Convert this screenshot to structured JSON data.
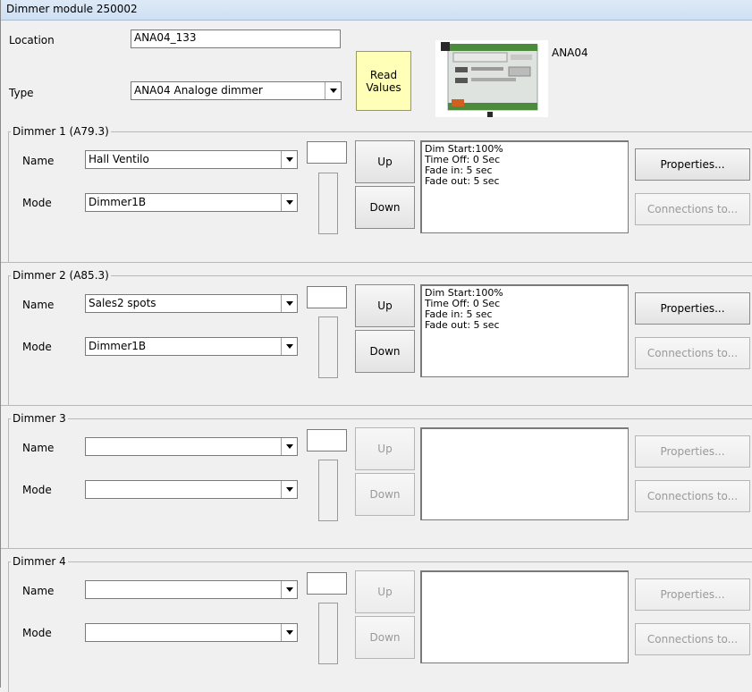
{
  "title": "Dimmer module 250002",
  "location": {
    "label": "Location",
    "value": "ANA04_133"
  },
  "type": {
    "label": "Type",
    "value": "ANA04 Analoge dimmer"
  },
  "read_values": {
    "label_line1": "Read",
    "label_line2": "Values"
  },
  "device_image_label": "ANA04",
  "dimmers": [
    {
      "legend": "Dimmer 1 (A79.3)",
      "name_label": "Name",
      "name_value": "Hall Ventilo",
      "mode_label": "Mode",
      "mode_value": "Dimmer1B",
      "up": "Up",
      "down": "Down",
      "info": [
        "Dim Start:100%",
        "Time Off: 0 Sec",
        "Fade in:  5 sec",
        "Fade out:  5 sec"
      ],
      "properties": "Properties...",
      "connections": "Connections to..."
    },
    {
      "legend": "Dimmer 2 (A85.3)",
      "name_label": "Name",
      "name_value": "Sales2 spots",
      "mode_label": "Mode",
      "mode_value": "Dimmer1B",
      "up": "Up",
      "down": "Down",
      "info": [
        "Dim Start:100%",
        "Time Off: 0 Sec",
        "Fade in:  5 sec",
        "Fade out:  5 sec"
      ],
      "properties": "Properties...",
      "connections": "Connections to..."
    },
    {
      "legend": "Dimmer 3",
      "name_label": "Name",
      "name_value": "",
      "mode_label": "Mode",
      "mode_value": "",
      "up": "Up",
      "down": "Down",
      "info": [
        "",
        "",
        "",
        ""
      ],
      "properties": "Properties...",
      "connections": "Connections to..."
    },
    {
      "legend": "Dimmer 4",
      "name_label": "Name",
      "name_value": "",
      "mode_label": "Mode",
      "mode_value": "",
      "up": "Up",
      "down": "Down",
      "info": [
        "",
        "",
        "",
        ""
      ],
      "properties": "Properties...",
      "connections": "Connections to..."
    }
  ]
}
